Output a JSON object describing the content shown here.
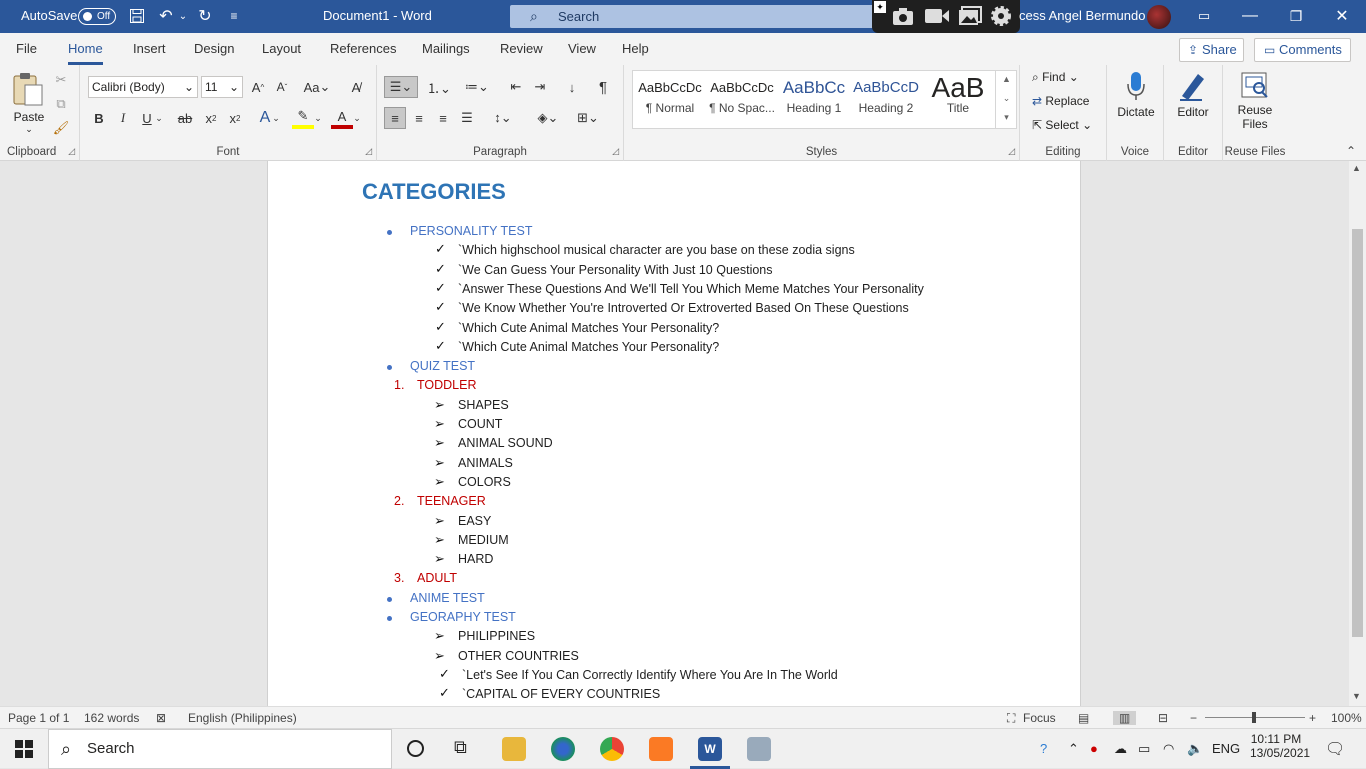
{
  "titlebar": {
    "autosave_label": "AutoSave",
    "autosave_state": "Off",
    "doc_title": "Document1  -  Word",
    "search_placeholder": "Search",
    "user_name": "cess Angel Bermundo"
  },
  "tabs": [
    "File",
    "Home",
    "Insert",
    "Design",
    "Layout",
    "References",
    "Mailings",
    "Review",
    "View",
    "Help"
  ],
  "active_tab": "Home",
  "share_label": "Share",
  "comments_label": "Comments",
  "ribbon": {
    "clipboard": {
      "paste_label": "Paste",
      "group_label": "Clipboard"
    },
    "font": {
      "font_name": "Calibri (Body)",
      "font_size": "11",
      "case_label": "Aa",
      "group_label": "Font"
    },
    "paragraph": {
      "group_label": "Paragraph"
    },
    "styles": {
      "items": [
        {
          "preview": "AaBbCcDc",
          "name": "¶ Normal"
        },
        {
          "preview": "AaBbCcDc",
          "name": "¶ No Spac..."
        },
        {
          "preview": "AaBbCc",
          "name": "Heading 1"
        },
        {
          "preview": "AaBbCcD",
          "name": "Heading 2"
        },
        {
          "preview": "AaB",
          "name": "Title"
        }
      ],
      "group_label": "Styles"
    },
    "editing": {
      "find": "Find",
      "replace": "Replace",
      "select": "Select",
      "group_label": "Editing"
    },
    "voice": {
      "dictate": "Dictate",
      "group_label": "Voice"
    },
    "editor": {
      "editor": "Editor",
      "group_label": "Editor"
    },
    "reuse": {
      "label_line1": "Reuse",
      "label_line2": "Files",
      "group_label": "Reuse Files"
    }
  },
  "document": {
    "heading": "CATEGORIES",
    "lines": [
      {
        "type": "bullet",
        "text": "PERSONALITY TEST"
      },
      {
        "type": "check",
        "text": "`Which highschool musical character are you base on these    zodia signs"
      },
      {
        "type": "check",
        "text": "`We Can Guess Your Personality With Just 10 Questions"
      },
      {
        "type": "check",
        "text": "`Answer These Questions And We'll Tell You Which Meme Matches Your Personality"
      },
      {
        "type": "check",
        "text": "`We Know Whether You're Introverted Or Extroverted Based On These Questions"
      },
      {
        "type": "check",
        "text": "`Which Cute Animal Matches Your Personality?"
      },
      {
        "type": "check",
        "text": "`Which Cute Animal Matches Your Personality?"
      },
      {
        "type": "bullet",
        "text": "QUIZ TEST"
      },
      {
        "type": "number",
        "num": "1.",
        "text": "TODDLER"
      },
      {
        "type": "arrow",
        "text": "SHAPES"
      },
      {
        "type": "arrow",
        "text": "COUNT"
      },
      {
        "type": "arrow",
        "text": "ANIMAL SOUND"
      },
      {
        "type": "arrow",
        "text": "ANIMALS"
      },
      {
        "type": "arrow",
        "text": "COLORS"
      },
      {
        "type": "number",
        "num": "2.",
        "text": "TEENAGER"
      },
      {
        "type": "arrow",
        "text": "EASY"
      },
      {
        "type": "arrow",
        "text": "MEDIUM"
      },
      {
        "type": "arrow",
        "text": "HARD"
      },
      {
        "type": "number",
        "num": "3.",
        "text": "ADULT"
      },
      {
        "type": "bullet",
        "text": "ANIME TEST"
      },
      {
        "type": "bullet",
        "text": "GEORAPHY TEST"
      },
      {
        "type": "arrow",
        "text": "PHILIPPINES"
      },
      {
        "type": "arrow",
        "text": "OTHER COUNTRIES"
      },
      {
        "type": "check2",
        "text": "`Let's See If You Can Correctly Identify Where You Are In The World"
      },
      {
        "type": "check2",
        "text": "`CAPITAL OF EVERY COUNTRIES"
      }
    ]
  },
  "status": {
    "page": "Page 1 of 1",
    "words": "162 words",
    "language": "English (Philippines)",
    "focus": "Focus",
    "zoom": "100%"
  },
  "taskbar": {
    "search": "Search",
    "lang": "ENG",
    "time": "10:11 PM",
    "date": "13/05/2021"
  }
}
